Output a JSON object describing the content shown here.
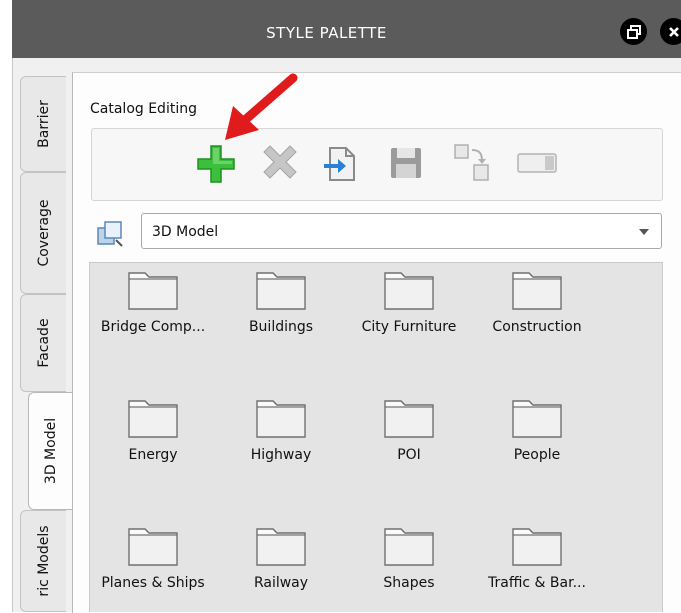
{
  "window": {
    "title": "STYLE PALETTE",
    "restore_icon": "restore-icon",
    "close_icon": "close-icon"
  },
  "tabs": [
    {
      "label": "Barrier"
    },
    {
      "label": "Coverage"
    },
    {
      "label": "Facade"
    },
    {
      "label": "3D Model",
      "active": true
    },
    {
      "label": "ric Models"
    }
  ],
  "catalog": {
    "label": "Catalog Editing",
    "tools": [
      "add-icon",
      "delete-icon",
      "import-icon",
      "save-icon",
      "copy-icon",
      "rename-icon"
    ]
  },
  "selector": {
    "value": "3D Model"
  },
  "folders": [
    {
      "label": "Bridge Comp..."
    },
    {
      "label": "Buildings"
    },
    {
      "label": "City Furniture"
    },
    {
      "label": "Construction"
    },
    {
      "label": "Energy"
    },
    {
      "label": "Highway"
    },
    {
      "label": "POI"
    },
    {
      "label": "People"
    },
    {
      "label": "Planes & Ships"
    },
    {
      "label": "Railway"
    },
    {
      "label": "Shapes"
    },
    {
      "label": "Traffic & Bar..."
    }
  ],
  "colors": {
    "titlebar": "#5b5b5b",
    "add": "#3cbf3c",
    "annotation_arrow": "#e01b1b"
  }
}
